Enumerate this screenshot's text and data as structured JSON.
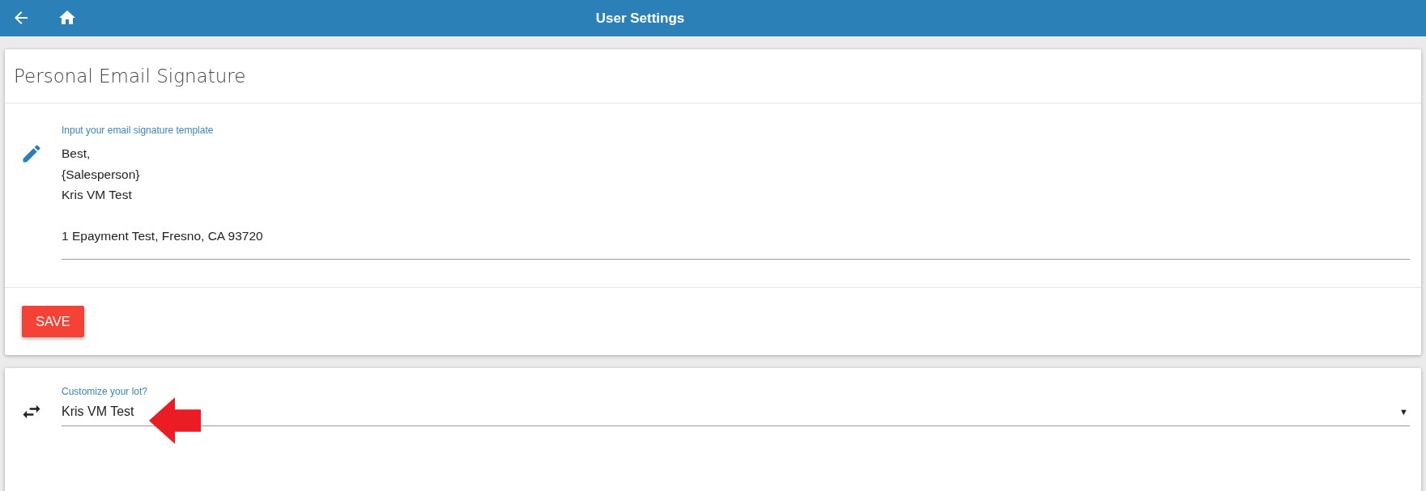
{
  "header": {
    "title": "User Settings"
  },
  "signature_card": {
    "title": "Personal Email Signature",
    "field": {
      "label": "Input your email signature template",
      "paragraphs": [
        {
          "lines": [
            "Best,",
            "{Salesperson}",
            "Kris VM Test"
          ]
        },
        {
          "lines": [
            "1 Epayment Test, Fresno, CA 93720"
          ]
        }
      ]
    },
    "save_button": "SAVE"
  },
  "lot_card": {
    "field": {
      "label": "Customize your lot?",
      "value": "Kris VM Test",
      "caret": "▼"
    }
  }
}
